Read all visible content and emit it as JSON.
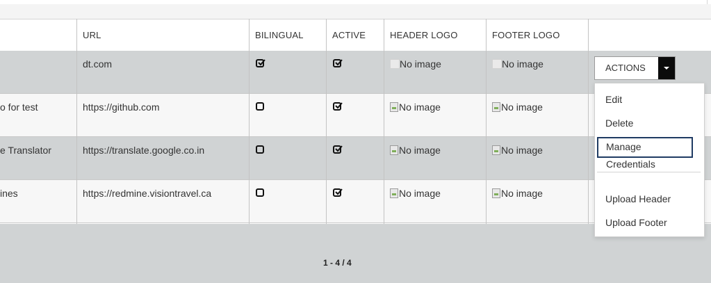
{
  "table": {
    "headers": [
      "URL",
      "BILINGUAL",
      "ACTIVE",
      "HEADER LOGO",
      "FOOTER LOGO"
    ],
    "rows": [
      {
        "name": "",
        "url": "dt.com",
        "bilingual": true,
        "active": true,
        "header_logo": "No image",
        "footer_logo": "No image"
      },
      {
        "name": "o for test",
        "url": "https://github.com",
        "bilingual": false,
        "active": true,
        "header_logo": "No image",
        "footer_logo": "No image"
      },
      {
        "name": "e Translator",
        "url": "https://translate.google.co.in",
        "bilingual": false,
        "active": true,
        "header_logo": "No image",
        "footer_logo": "No image"
      },
      {
        "name": "ines",
        "url": "https://redmine.visiontravel.ca",
        "bilingual": false,
        "active": true,
        "header_logo": "No image",
        "footer_logo": "No image"
      }
    ]
  },
  "actions": {
    "button_label": "ACTIONS",
    "menu": [
      "Edit",
      "Delete",
      "Manage Credentials",
      "Upload Header",
      "Upload Footer"
    ]
  },
  "pager": {
    "text": "1 - 4 / 4"
  },
  "icons": {
    "checked": "checked-box-icon",
    "unchecked": "unchecked-box-icon",
    "broken_image": "broken-image-icon",
    "caret": "caret-down-icon"
  }
}
